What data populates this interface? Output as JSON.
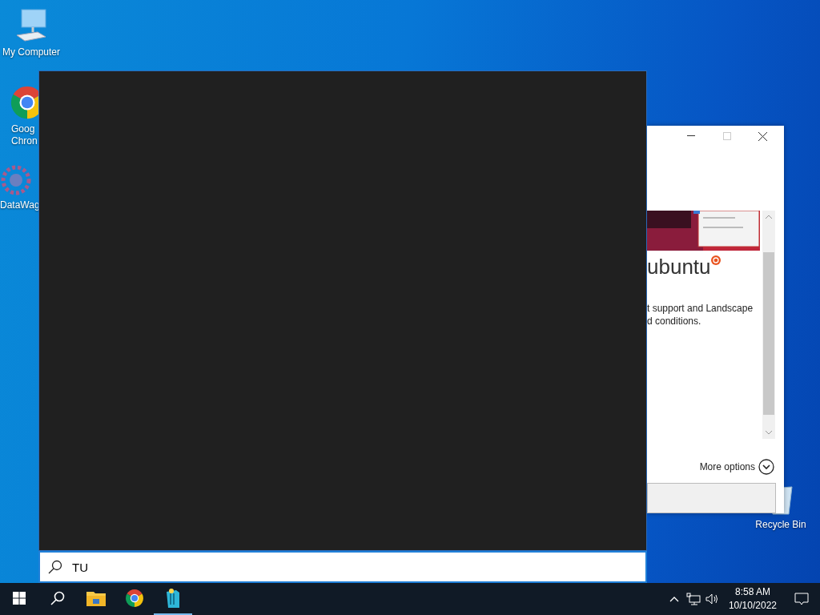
{
  "desktop_icons": [
    {
      "kind": "computer",
      "label": "My Computer"
    },
    {
      "kind": "chrome",
      "label": "Goog",
      "label_2": "Chron"
    },
    {
      "kind": "gear",
      "label": "DataWag"
    },
    {
      "kind": "recycle",
      "label": "Recycle Bin"
    }
  ],
  "background_window": {
    "logo_text": "ubuntu",
    "text_lines": [
      "t support and Landscape",
      "d conditions."
    ],
    "more_options": "More options"
  },
  "search": {
    "value": "TU"
  },
  "taskbar": {
    "items": [
      {
        "kind": "start",
        "running": false
      },
      {
        "kind": "search",
        "running": false
      },
      {
        "kind": "explorer",
        "running": false
      },
      {
        "kind": "chrome",
        "running": false
      },
      {
        "kind": "app",
        "running": true
      }
    ],
    "time": "8:58 AM",
    "date": "10/10/2022"
  }
}
